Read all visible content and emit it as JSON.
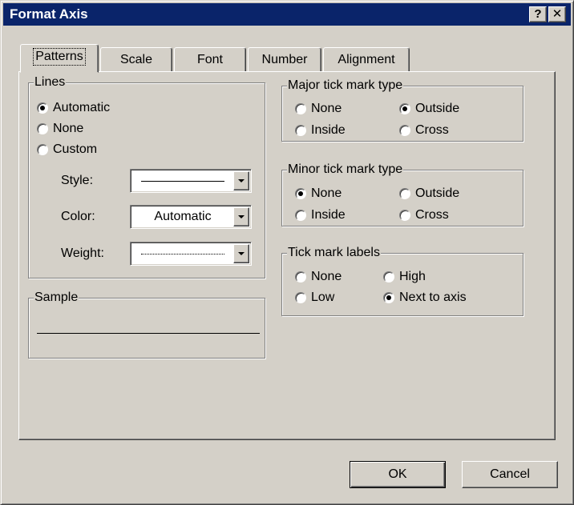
{
  "window": {
    "title": "Format Axis",
    "help_glyph": "?",
    "close_glyph": "✕"
  },
  "tabs": [
    {
      "label": "Patterns",
      "active": true
    },
    {
      "label": "Scale"
    },
    {
      "label": "Font"
    },
    {
      "label": "Number"
    },
    {
      "label": "Alignment"
    }
  ],
  "lines": {
    "legend": "Lines",
    "options": [
      {
        "label": "Automatic",
        "checked": true
      },
      {
        "label": "None"
      },
      {
        "label": "Custom"
      }
    ],
    "style_label": "Style:",
    "color_label": "Color:",
    "color_value": "Automatic",
    "weight_label": "Weight:"
  },
  "sample": {
    "legend": "Sample"
  },
  "major": {
    "legend": "Major tick mark type",
    "options": [
      {
        "label": "None"
      },
      {
        "label": "Outside",
        "checked": true
      },
      {
        "label": "Inside"
      },
      {
        "label": "Cross"
      }
    ]
  },
  "minor": {
    "legend": "Minor tick mark type",
    "options": [
      {
        "label": "None",
        "checked": true
      },
      {
        "label": "Outside"
      },
      {
        "label": "Inside"
      },
      {
        "label": "Cross"
      }
    ]
  },
  "labels": {
    "legend": "Tick mark labels",
    "options": [
      {
        "label": "None"
      },
      {
        "label": "High"
      },
      {
        "label": "Low"
      },
      {
        "label": "Next to axis",
        "checked": true
      }
    ]
  },
  "buttons": {
    "ok": "OK",
    "cancel": "Cancel"
  },
  "colors": {
    "title_bar": "#0a246a",
    "face": "#d4d0c8"
  }
}
